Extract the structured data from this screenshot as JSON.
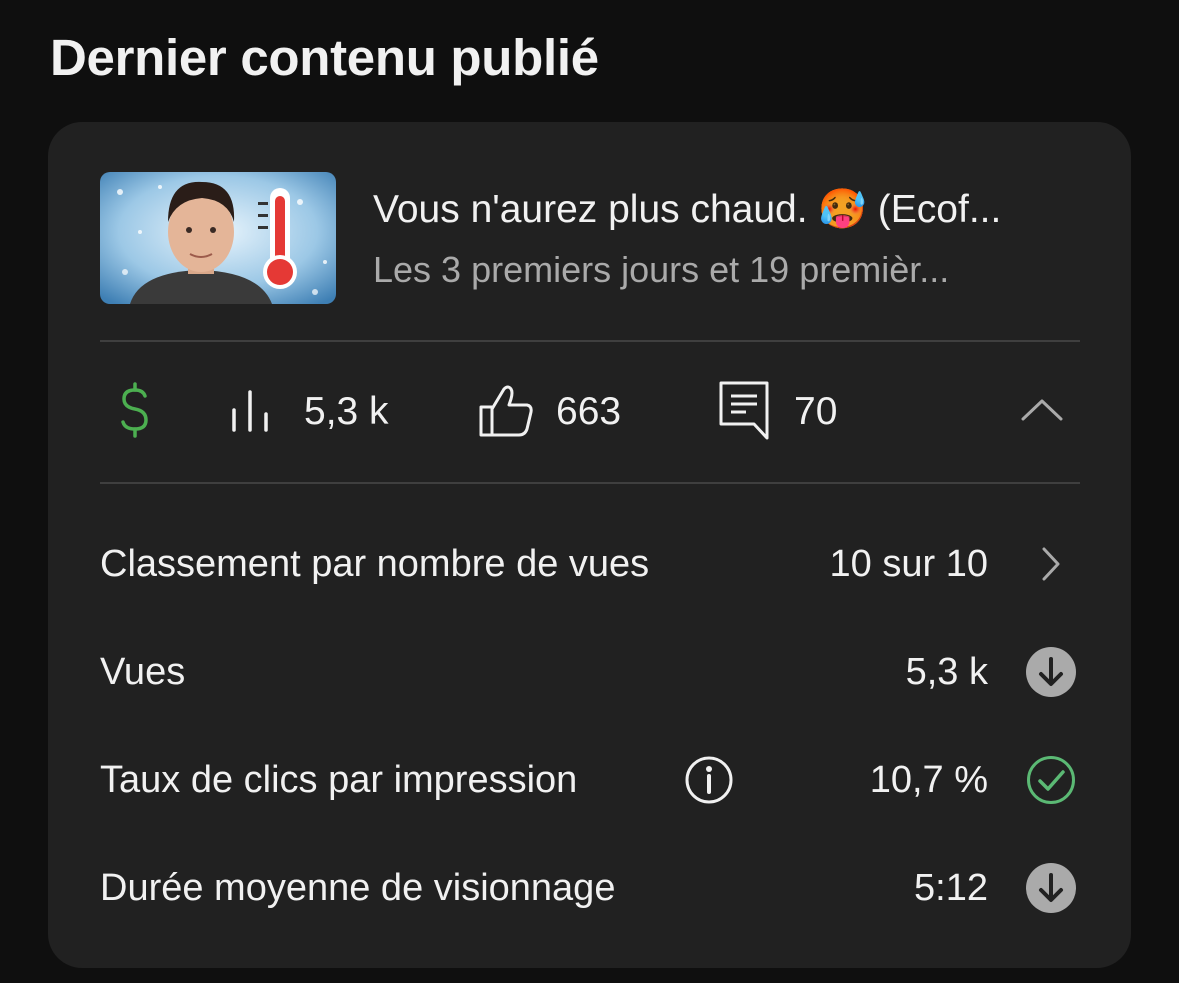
{
  "section_title": "Dernier contenu publié",
  "video": {
    "title": "Vous n'aurez plus chaud. 🥵 (Ecof...",
    "subtitle": "Les 3 premiers jours et 19 premièr..."
  },
  "stats": {
    "views": "5,3 k",
    "likes": "663",
    "comments": "70"
  },
  "metrics": [
    {
      "label": "Classement par nombre de vues",
      "value": "10 sur 10",
      "icon": "chevron-right-icon"
    },
    {
      "label": "Vues",
      "value": "5,3 k",
      "icon": "arrow-down-circle-icon"
    },
    {
      "label": "Taux de clics par impression",
      "value": "10,7 %",
      "icon": "check-circle-icon"
    },
    {
      "label": "Durée moyenne de visionnage",
      "value": "5:12",
      "icon": "arrow-down-circle-icon"
    }
  ],
  "colors": {
    "background": "#0f0f0f",
    "card": "#212121",
    "money_green": "#4caf50",
    "check_green": "#5bb974",
    "muted_text": "#aaaaaa",
    "icon_gray": "#aaaaaa"
  }
}
